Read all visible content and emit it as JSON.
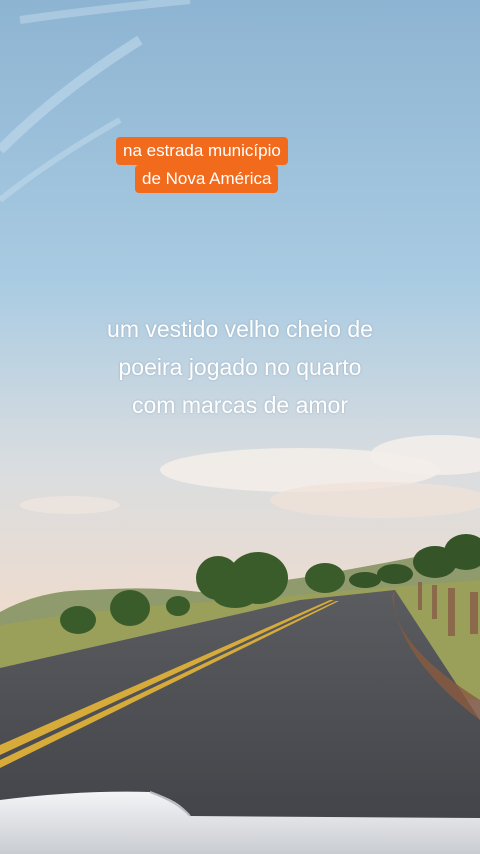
{
  "overlay": {
    "tag_line_1": "na estrada município",
    "tag_line_2": "de Nova América",
    "caption_lines": [
      "um vestido velho cheio de",
      "poeira jogado no quarto",
      "com marcas de amor"
    ],
    "tag_color": "#f26b1d",
    "caption_color": "#ffffff"
  },
  "scene": {
    "sky_top_color": "#8fb6d3",
    "sky_horizon_color": "#e9d9cf",
    "road_color": "#4b4d52",
    "center_line_color": "#e0b23a"
  }
}
